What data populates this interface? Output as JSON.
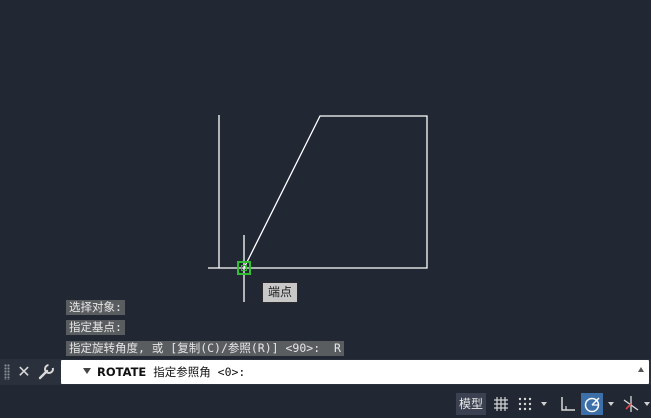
{
  "tooltip": {
    "text": "端点"
  },
  "history": [
    "选择对象:",
    "指定基点:",
    "指定旋转角度, 或 [复制(C)/参照(R)] <90>:  R"
  ],
  "command": {
    "name": "ROTATE",
    "prompt": " 指定参照角 <0>:"
  },
  "statusbar": {
    "model_label": "模型"
  },
  "colors": {
    "canvas": "#212733",
    "geometry": "#ffffff",
    "snap_marker": "#2fbf2f",
    "active_toggle": "#3d6fa8"
  },
  "icons": [
    "close-icon",
    "wrench-icon",
    "grid-icon",
    "snap-grid-icon",
    "ortho-icon",
    "polar-tracking-icon",
    "isodraft-icon"
  ]
}
